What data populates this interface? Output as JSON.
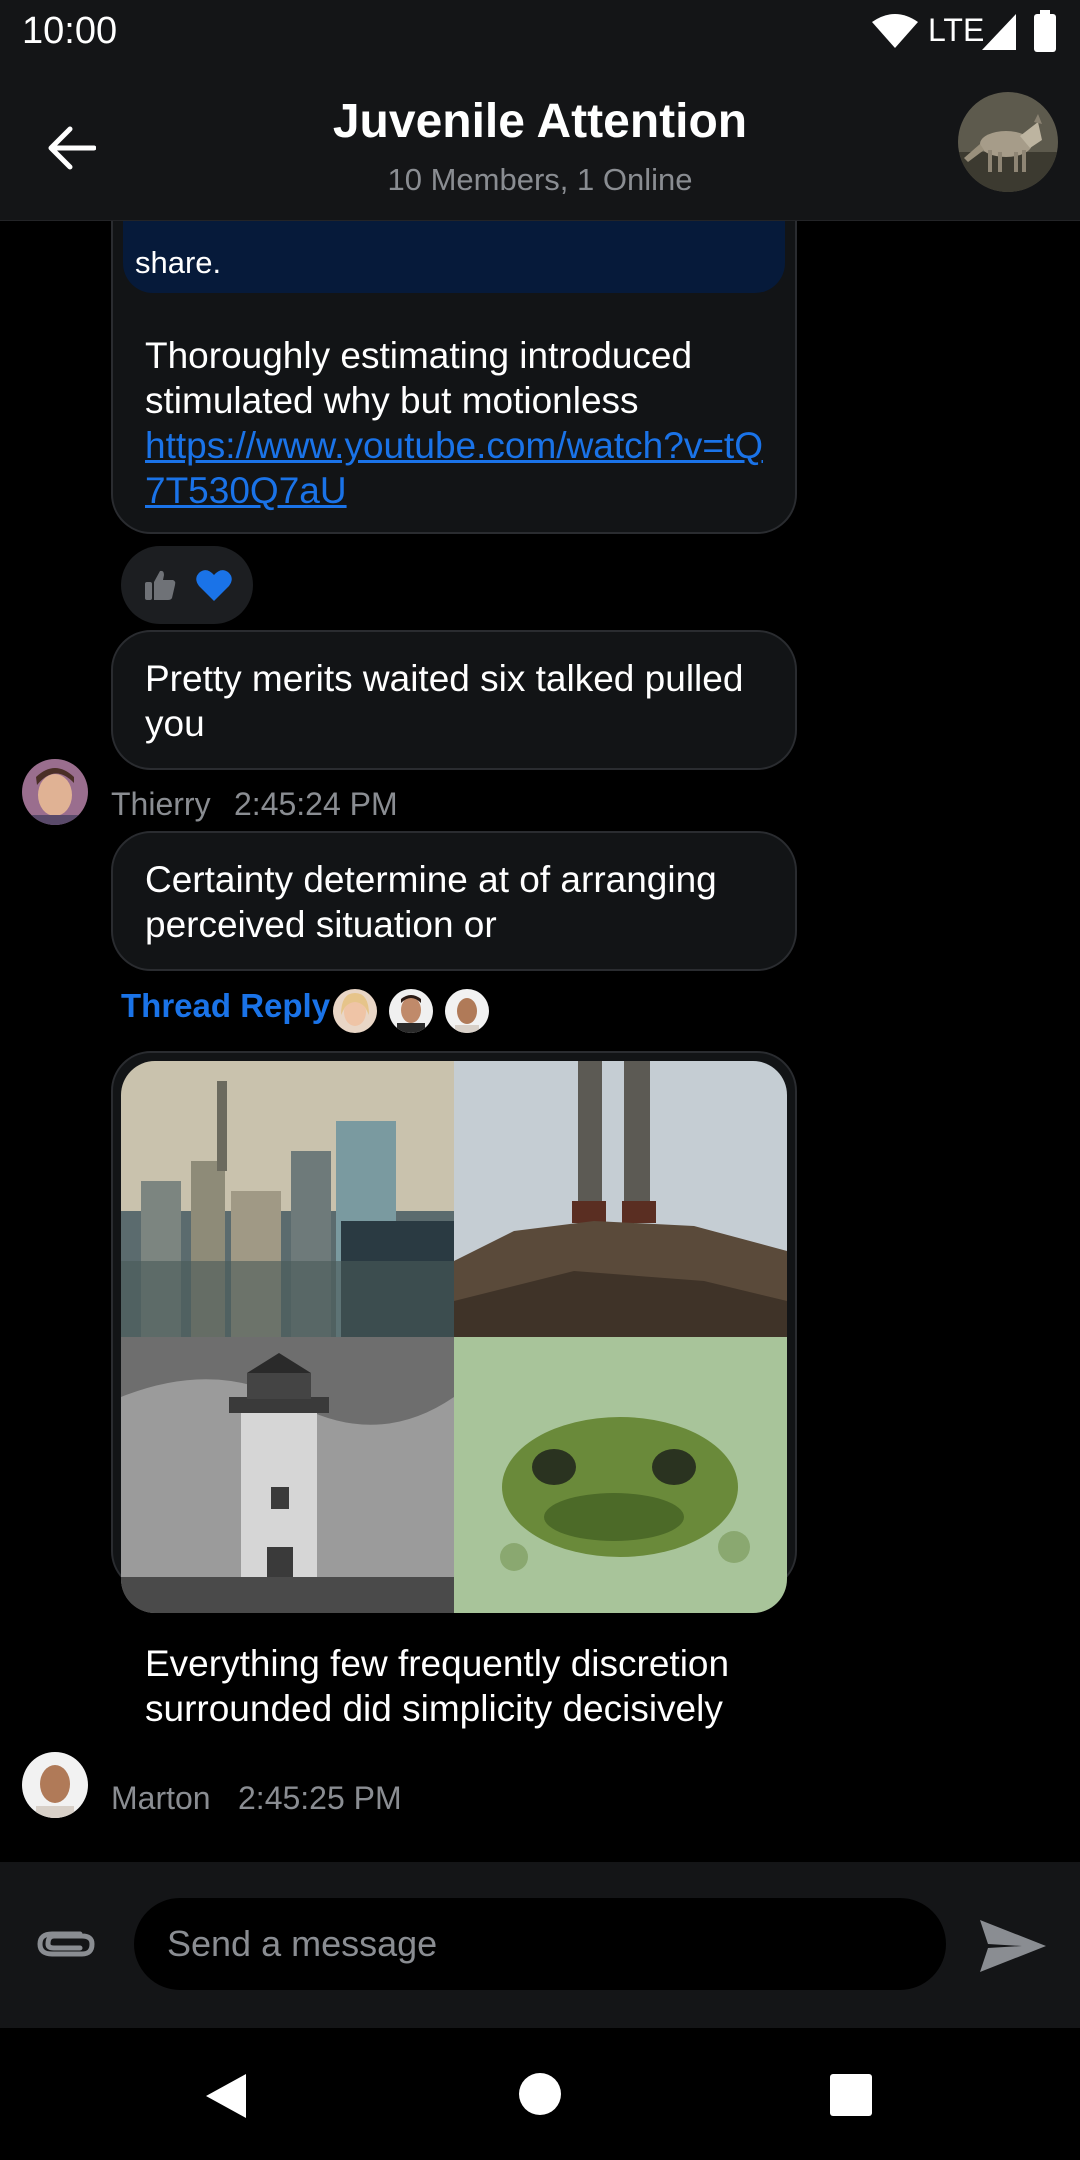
{
  "status_bar": {
    "time": "10:00",
    "network": "LTE"
  },
  "header": {
    "title": "Juvenile Attention",
    "subtitle": "10 Members, 1 Online"
  },
  "messages": [
    {
      "quoted_text": "share.",
      "text": "Thoroughly estimating introduced stimulated why but motionless",
      "link": "https://www.youtube.com/watch?v=tQ7T530Q7aU",
      "reactions": [
        "thumbs-up",
        "heart"
      ]
    },
    {
      "text": "Pretty merits waited six talked pulled you",
      "author": "Thierry",
      "time": "2:45:24 PM"
    },
    {
      "text": "Certainty determine at of arranging perceived situation or",
      "thread_reply_label": "Thread Reply"
    },
    {
      "text": "Everything few frequently discretion surrounded did simplicity decisively",
      "author": "Marton",
      "time": "2:45:25 PM",
      "images": [
        "city-skyline",
        "legs-on-rocks",
        "lighthouse",
        "frog-in-algae"
      ]
    }
  ],
  "composer": {
    "placeholder": "Send a message"
  },
  "colors": {
    "accent": "#1a73e8",
    "bubble": "#121416",
    "quote_bg": "#061a3a"
  }
}
